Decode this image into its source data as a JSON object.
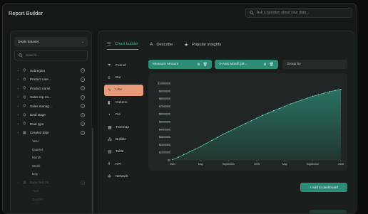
{
  "app": {
    "title": "Report Builder"
  },
  "ask": {
    "placeholder": "Ask a question about your data..."
  },
  "sidebar": {
    "dataset": "Deals dataset",
    "search_placeholder": "Search...",
    "fields": [
      {
        "label": "Subregion",
        "icon": "hierarchy-icon"
      },
      {
        "label": "Product cate...",
        "icon": "hierarchy-icon"
      },
      {
        "label": "Product name",
        "icon": "hierarchy-icon"
      },
      {
        "label": "Sales rep na...",
        "icon": "hierarchy-icon"
      },
      {
        "label": "Sales manag...",
        "icon": "hierarchy-icon"
      },
      {
        "label": "Deal stage",
        "icon": "hierarchy-icon"
      },
      {
        "label": "Deal type",
        "icon": "hierarchy-icon"
      },
      {
        "label": "Created date",
        "icon": "calendar-icon"
      }
    ],
    "date_parts": [
      "Year",
      "Quarter",
      "Month",
      "Week",
      "Day"
    ],
    "faded_field": "Expected clo...",
    "faded_parts": [
      "Year",
      "Quarter"
    ]
  },
  "tabs": [
    {
      "label": "Chart builder",
      "icon": "list-icon"
    },
    {
      "label": "Describe",
      "icon": "text-icon"
    },
    {
      "label": "Popular insights",
      "icon": "star-icon"
    }
  ],
  "chart_types": [
    {
      "label": "Funnel",
      "icon": "funnel-icon"
    },
    {
      "label": "Bar",
      "icon": "bar-icon"
    },
    {
      "label": "Line",
      "icon": "line-icon"
    },
    {
      "label": "Column",
      "icon": "column-icon"
    },
    {
      "label": "Pie",
      "icon": "pie-icon"
    },
    {
      "label": "Treemap",
      "icon": "treemap-icon"
    },
    {
      "label": "Bubble",
      "icon": "bubble-icon"
    },
    {
      "label": "Table",
      "icon": "table-icon"
    },
    {
      "label": "KPI",
      "icon": "kpi-icon"
    },
    {
      "label": "Network",
      "icon": "network-icon"
    }
  ],
  "active_chart_type": "Line",
  "measure": {
    "label": "Measure Amount"
  },
  "xaxis": {
    "label": "X-Axis Month (M..."
  },
  "groupby": {
    "label": "Group by"
  },
  "add_button": {
    "label": "+ Add to dashboard"
  },
  "colors": {
    "accent": "#2c8c76",
    "active_type": "#e89b7a",
    "line": "#49b197"
  },
  "chart_data": {
    "type": "area",
    "title": "",
    "xlabel": "",
    "ylabel": "",
    "ylim": [
      0,
      10000000
    ],
    "yticks": [
      "$0",
      "$1000000",
      "$2000000",
      "$3000000",
      "$4000000",
      "$5000000",
      "$6000000",
      "$7000000",
      "$8000000",
      "$9000000",
      "$10000000"
    ],
    "xticks": [
      {
        "label": "2024",
        "index": 0
      },
      {
        "label": "May",
        "index": 5
      },
      {
        "label": "September",
        "index": 10
      },
      {
        "label": "2025",
        "index": 15
      },
      {
        "label": "May",
        "index": 20
      },
      {
        "label": "September",
        "index": 25
      },
      {
        "label": "2026",
        "index": 30
      }
    ],
    "series": [
      {
        "values": [
          50000,
          350000,
          700000,
          1050000,
          1400000,
          1750000,
          2150000,
          2550000,
          2950000,
          3350000,
          3700000,
          4050000,
          4400000,
          4750000,
          5100000,
          5450000,
          5800000,
          6100000,
          6400000,
          6700000,
          7000000,
          7300000,
          7550000,
          7800000,
          8050000,
          8300000,
          8500000,
          8700000,
          8900000,
          9050000,
          9200000
        ]
      }
    ]
  }
}
